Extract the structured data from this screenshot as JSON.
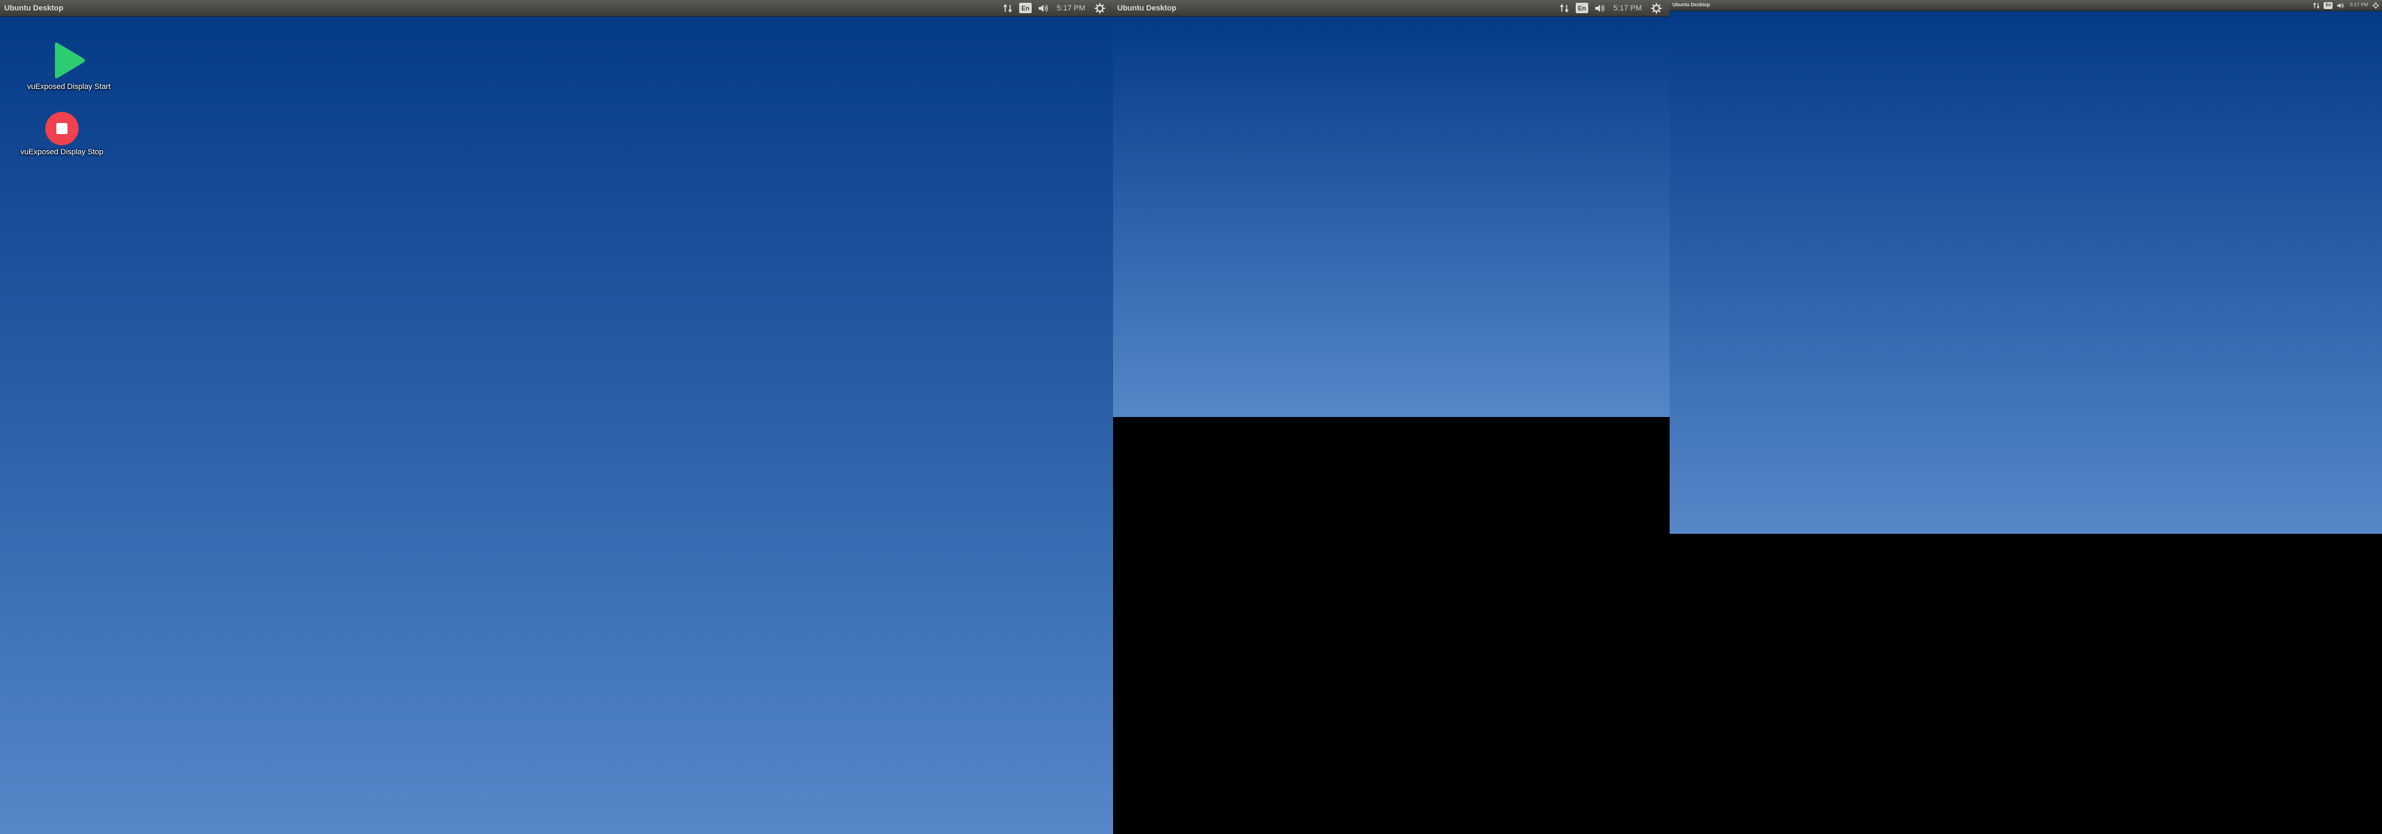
{
  "screens": [
    {
      "panel": {
        "title": "Ubuntu Desktop",
        "indicators": [
          "network-icon",
          "keyboard-layout-icon",
          "sound-icon"
        ],
        "keyboard_layout": "En",
        "clock": "5:17 PM",
        "session_icon": "gear-icon"
      },
      "desktop_icons": [
        {
          "label": "vuExposed Display Start",
          "icon": "play-icon",
          "color": "#2ecc71"
        },
        {
          "label": "vuExposed Display Stop",
          "icon": "stop-icon",
          "color": "#f0414f"
        }
      ]
    },
    {
      "panel": {
        "title": "Ubuntu Desktop",
        "keyboard_layout": "En",
        "clock": "5:17 PM"
      }
    },
    {
      "panel": {
        "title": "Ubuntu Desktop",
        "keyboard_layout": "En",
        "clock": "5:17 PM"
      }
    }
  ],
  "colors": {
    "wallpaper_top": "#053a87",
    "wallpaper_bottom": "#5687c9",
    "panel": "#3c3b37",
    "uncovered_area": "#000000"
  }
}
